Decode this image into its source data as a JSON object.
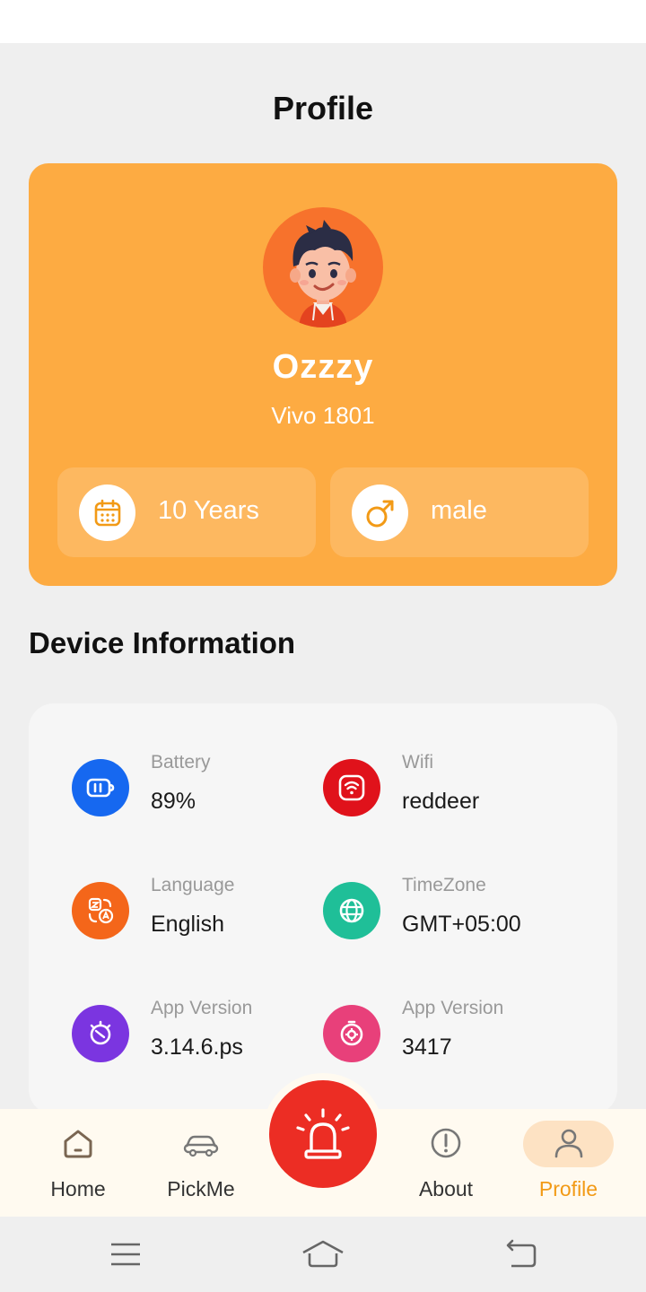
{
  "header": {
    "title": "Profile"
  },
  "profile": {
    "name": "Ozzzy",
    "device": "Vivo 1801",
    "age_label": "10 Years",
    "gender_label": "male"
  },
  "device_info": {
    "title": "Device Information",
    "items": [
      {
        "label": "Battery",
        "value": "89%",
        "icon": "battery-icon",
        "color": "#1668f0"
      },
      {
        "label": "Wifi",
        "value": "reddeer",
        "icon": "wifi-icon",
        "color": "#e0121b"
      },
      {
        "label": "Language",
        "value": "English",
        "icon": "translate-icon",
        "color": "#f4661a"
      },
      {
        "label": "TimeZone",
        "value": "GMT+05:00",
        "icon": "globe-icon",
        "color": "#1fbf98"
      },
      {
        "label": "App Version",
        "value": "3.14.6.ps",
        "icon": "timer-icon",
        "color": "#7b35e0"
      },
      {
        "label": "App Version",
        "value": "3417",
        "icon": "gear-clock-icon",
        "color": "#e8407a"
      }
    ]
  },
  "bottom_nav": {
    "items": [
      {
        "label": "Home",
        "icon": "home-icon"
      },
      {
        "label": "PickMe",
        "icon": "car-icon"
      },
      {
        "label": "About",
        "icon": "info-icon"
      },
      {
        "label": "Profile",
        "icon": "user-icon",
        "active": true
      }
    ],
    "sos_icon": "alarm-siren-icon"
  },
  "colors": {
    "accent": "#fdab42",
    "active_nav": "#f29a16",
    "sos": "#ec2d24"
  }
}
